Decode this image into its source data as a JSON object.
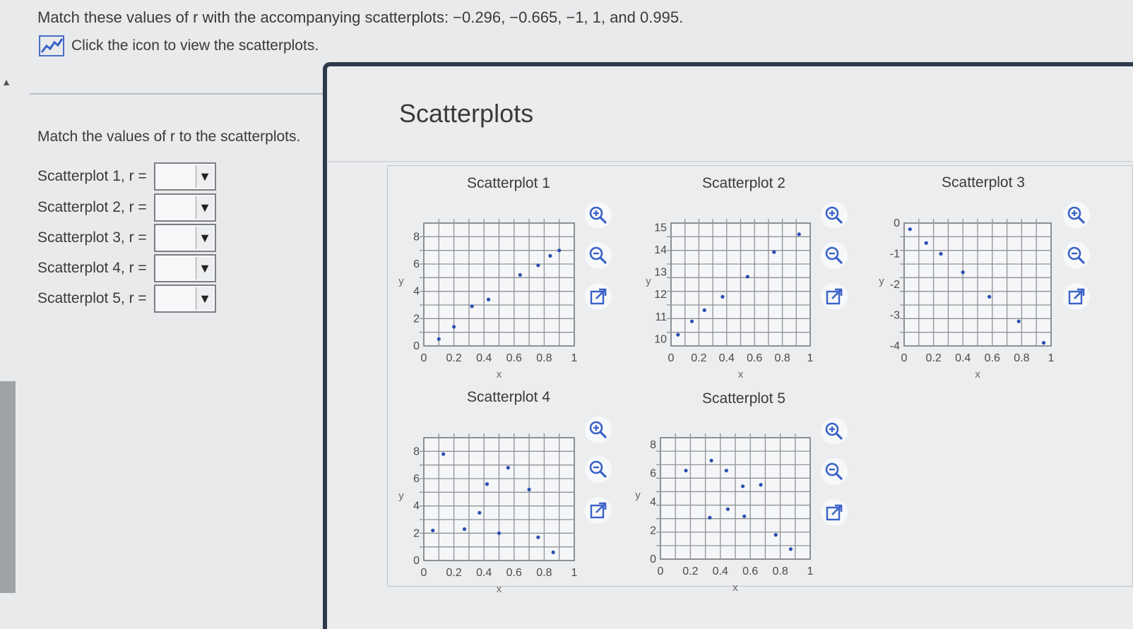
{
  "question": {
    "text": "Match these values of r with the accompanying scatterplots:  −0.296,  −0.665,  −1, 1, and 0.995.",
    "icon_link_label": "Click the icon to view the scatterplots."
  },
  "left_panel": {
    "instruction": "Match the values of r to the scatterplots.",
    "rows": [
      {
        "label": "Scatterplot 1, r =",
        "value": ""
      },
      {
        "label": "Scatterplot 2, r =",
        "value": ""
      },
      {
        "label": "Scatterplot 3, r =",
        "value": ""
      },
      {
        "label": "Scatterplot 4, r =",
        "value": ""
      },
      {
        "label": "Scatterplot 5, r =",
        "value": ""
      }
    ]
  },
  "popup": {
    "title": "Scatterplots"
  },
  "colors": {
    "point": "#2a4fb0",
    "popup_border": "#2e3a4a"
  },
  "icons": [
    "chart-line-icon",
    "zoom-in-icon",
    "zoom-out-icon",
    "external-link-icon",
    "dropdown-arrow-icon"
  ],
  "chart_data": [
    {
      "type": "scatter",
      "title": "Scatterplot 1",
      "xlabel": "x",
      "ylabel": "y",
      "xlim": [
        0,
        1
      ],
      "ylim": [
        0,
        9
      ],
      "xticks": [
        "0",
        "0.2",
        "0.4",
        "0.6",
        "0.8",
        "1"
      ],
      "yticks": [
        "0",
        "2",
        "4",
        "6",
        "8"
      ],
      "ytick_values": [
        0,
        2,
        4,
        6,
        8
      ],
      "x": [
        0.1,
        0.2,
        0.32,
        0.43,
        0.64,
        0.76,
        0.84,
        0.9
      ],
      "y": [
        0.5,
        1.4,
        2.9,
        3.4,
        5.2,
        5.9,
        6.6,
        7.0
      ]
    },
    {
      "type": "scatter",
      "title": "Scatterplot 2",
      "xlabel": "x",
      "ylabel": "y",
      "xlim": [
        0,
        1
      ],
      "ylim": [
        9.7,
        15.2
      ],
      "xticks": [
        "0",
        "0.2",
        "0.4",
        "0.6",
        "0.8",
        "1"
      ],
      "yticks": [
        "10",
        "11",
        "12",
        "13",
        "14",
        "15"
      ],
      "ytick_values": [
        10,
        11,
        12,
        13,
        14,
        15
      ],
      "x": [
        0.05,
        0.15,
        0.24,
        0.37,
        0.55,
        0.74,
        0.92
      ],
      "y": [
        10.2,
        10.8,
        11.3,
        11.9,
        12.8,
        13.9,
        14.7
      ]
    },
    {
      "type": "scatter",
      "title": "Scatterplot 3",
      "xlabel": "x",
      "ylabel": "y",
      "xlim": [
        0,
        1
      ],
      "ylim": [
        -4,
        0
      ],
      "xticks": [
        "0",
        "0.2",
        "0.4",
        "0.6",
        "0.8",
        "1"
      ],
      "yticks": [
        "0",
        "-1",
        "-2",
        "-3",
        "-4"
      ],
      "ytick_values": [
        0,
        -1,
        -2,
        -3,
        -4
      ],
      "x": [
        0.04,
        0.15,
        0.25,
        0.4,
        0.58,
        0.78,
        0.95
      ],
      "y": [
        -0.2,
        -0.65,
        -1.0,
        -1.6,
        -2.4,
        -3.2,
        -3.9
      ]
    },
    {
      "type": "scatter",
      "title": "Scatterplot 4",
      "xlabel": "x",
      "ylabel": "y",
      "xlim": [
        0,
        1
      ],
      "ylim": [
        0,
        9
      ],
      "xticks": [
        "0",
        "0.2",
        "0.4",
        "0.6",
        "0.8",
        "1"
      ],
      "yticks": [
        "0",
        "2",
        "4",
        "6",
        "8"
      ],
      "ytick_values": [
        0,
        2,
        4,
        6,
        8
      ],
      "x": [
        0.06,
        0.13,
        0.27,
        0.37,
        0.42,
        0.5,
        0.56,
        0.7,
        0.76,
        0.86
      ],
      "y": [
        2.2,
        7.8,
        2.3,
        3.5,
        5.6,
        2.0,
        6.8,
        5.2,
        1.7,
        0.6
      ]
    },
    {
      "type": "scatter",
      "title": "Scatterplot 5",
      "xlabel": "x",
      "ylabel": "y",
      "xlim": [
        0,
        1
      ],
      "ylim": [
        0,
        8.5
      ],
      "xticks": [
        "0",
        "0.2",
        "0.4",
        "0.6",
        "0.8",
        "1"
      ],
      "yticks": [
        "0",
        "2",
        "4",
        "6",
        "8"
      ],
      "ytick_values": [
        0,
        2,
        4,
        6,
        8
      ],
      "x": [
        0.17,
        0.33,
        0.34,
        0.44,
        0.45,
        0.55,
        0.56,
        0.67,
        0.77,
        0.87
      ],
      "y": [
        6.2,
        2.9,
        6.9,
        6.2,
        3.5,
        5.1,
        3.0,
        5.2,
        1.7,
        0.7
      ]
    }
  ]
}
